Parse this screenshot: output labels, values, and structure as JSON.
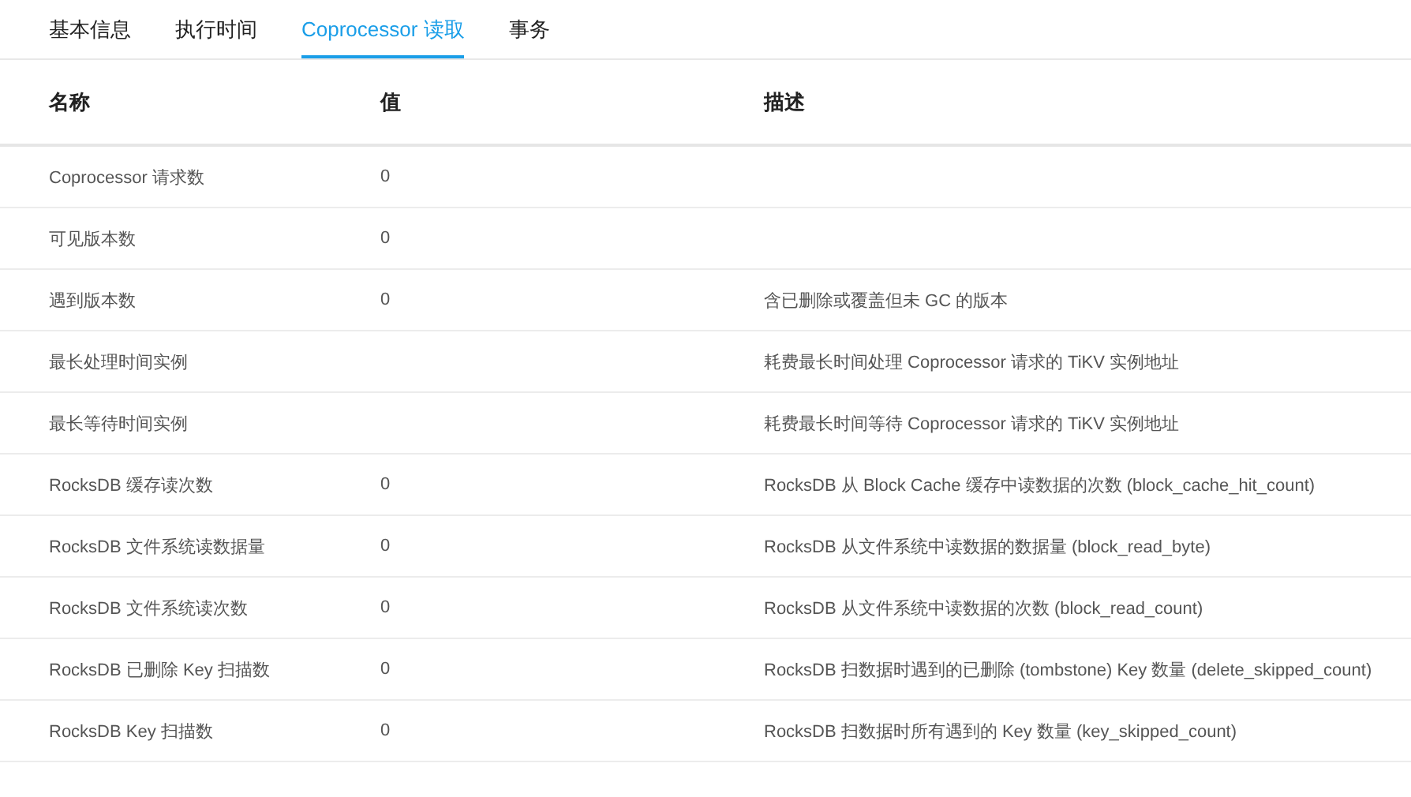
{
  "tabs": [
    {
      "label": "基本信息",
      "selected": false
    },
    {
      "label": "执行时间",
      "selected": false
    },
    {
      "label": "Coprocessor 读取",
      "selected": true
    },
    {
      "label": "事务",
      "selected": false
    }
  ],
  "table": {
    "columns": [
      "名称",
      "值",
      "描述"
    ],
    "rows": [
      [
        "Coprocessor 请求数",
        "0",
        ""
      ],
      [
        "可见版本数",
        "0",
        ""
      ],
      [
        "遇到版本数",
        "0",
        "含已删除或覆盖但未 GC 的版本"
      ],
      [
        "最长处理时间实例",
        "",
        "耗费最长时间处理 Coprocessor 请求的 TiKV 实例地址"
      ],
      [
        "最长等待时间实例",
        "",
        "耗费最长时间等待 Coprocessor 请求的 TiKV 实例地址"
      ],
      [
        "RocksDB 缓存读次数",
        "0",
        "RocksDB 从 Block Cache 缓存中读数据的次数 (block_cache_hit_count)"
      ],
      [
        "RocksDB 文件系统读数据量",
        "0",
        "RocksDB 从文件系统中读数据的数据量 (block_read_byte)"
      ],
      [
        "RocksDB 文件系统读次数",
        "0",
        "RocksDB 从文件系统中读数据的次数 (block_read_count)"
      ],
      [
        "RocksDB 已删除 Key 扫描数",
        "0",
        "RocksDB 扫数据时遇到的已删除 (tombstone) Key 数量 (delete_skipped_count)"
      ],
      [
        "RocksDB Key 扫描数",
        "0",
        "RocksDB 扫数据时所有遇到的 Key 数量 (key_skipped_count)"
      ]
    ]
  }
}
